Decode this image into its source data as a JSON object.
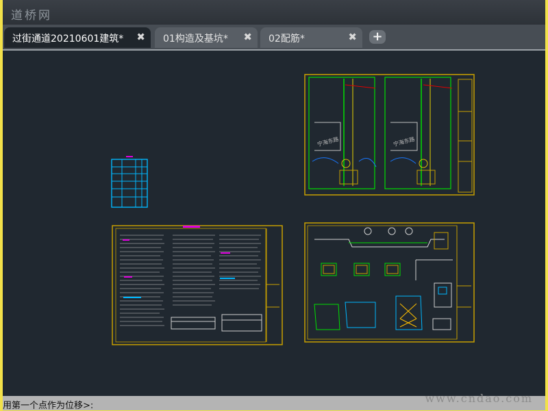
{
  "watermarks": {
    "top": "道桥网",
    "bottom": "www.cndao.com"
  },
  "tabs": [
    {
      "label": "过街通道20210601建筑*",
      "active": true
    },
    {
      "label": "01构造及基坑*",
      "active": false
    },
    {
      "label": "02配筋*",
      "active": false
    }
  ],
  "icons": {
    "tab_close": "close-icon",
    "add_tab": "plus-icon"
  },
  "symbols": {
    "close": "✖",
    "add": "+"
  },
  "drawing_labels": {
    "sheet_1_left": "宁海东路",
    "sheet_1_right": "宁海东路"
  },
  "command_line": {
    "text": "用第一个点作为位移>:"
  },
  "colors": {
    "canvas": "#202830",
    "sheet_border": "#c8a000",
    "green_line": "#00e000",
    "cyan_line": "#00b7ff",
    "magenta_text": "#e000e0"
  }
}
